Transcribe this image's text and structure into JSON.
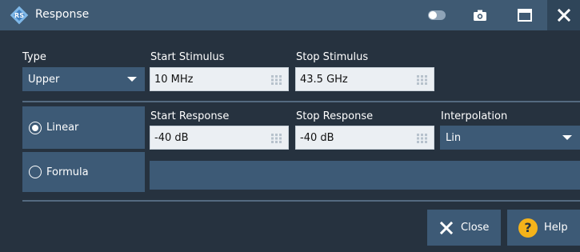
{
  "window": {
    "title": "Response",
    "icons": {
      "app": "rs-logo-icon",
      "toggle": "toggle-icon",
      "camera": "camera-icon",
      "maximize": "maximize-icon",
      "close": "close-icon"
    }
  },
  "type": {
    "label": "Type",
    "value": "Upper"
  },
  "start_stimulus": {
    "label": "Start Stimulus",
    "value": "10 MHz"
  },
  "stop_stimulus": {
    "label": "Stop Stimulus",
    "value": "43.5 GHz"
  },
  "mode": {
    "linear": {
      "label": "Linear",
      "selected": true
    },
    "formula": {
      "label": "Formula",
      "selected": false
    }
  },
  "start_response": {
    "label": "Start Response",
    "value": "-40 dB"
  },
  "stop_response": {
    "label": "Stop Response",
    "value": "-40 dB"
  },
  "interpolation": {
    "label": "Interpolation",
    "value": "Lin"
  },
  "buttons": {
    "close": "Close",
    "help": "Help"
  },
  "colors": {
    "titlebar": "#3f5a73",
    "panel": "#26323f",
    "control": "#3d5a76",
    "field": "#ebeff3",
    "help_accent": "#f5b31a"
  }
}
